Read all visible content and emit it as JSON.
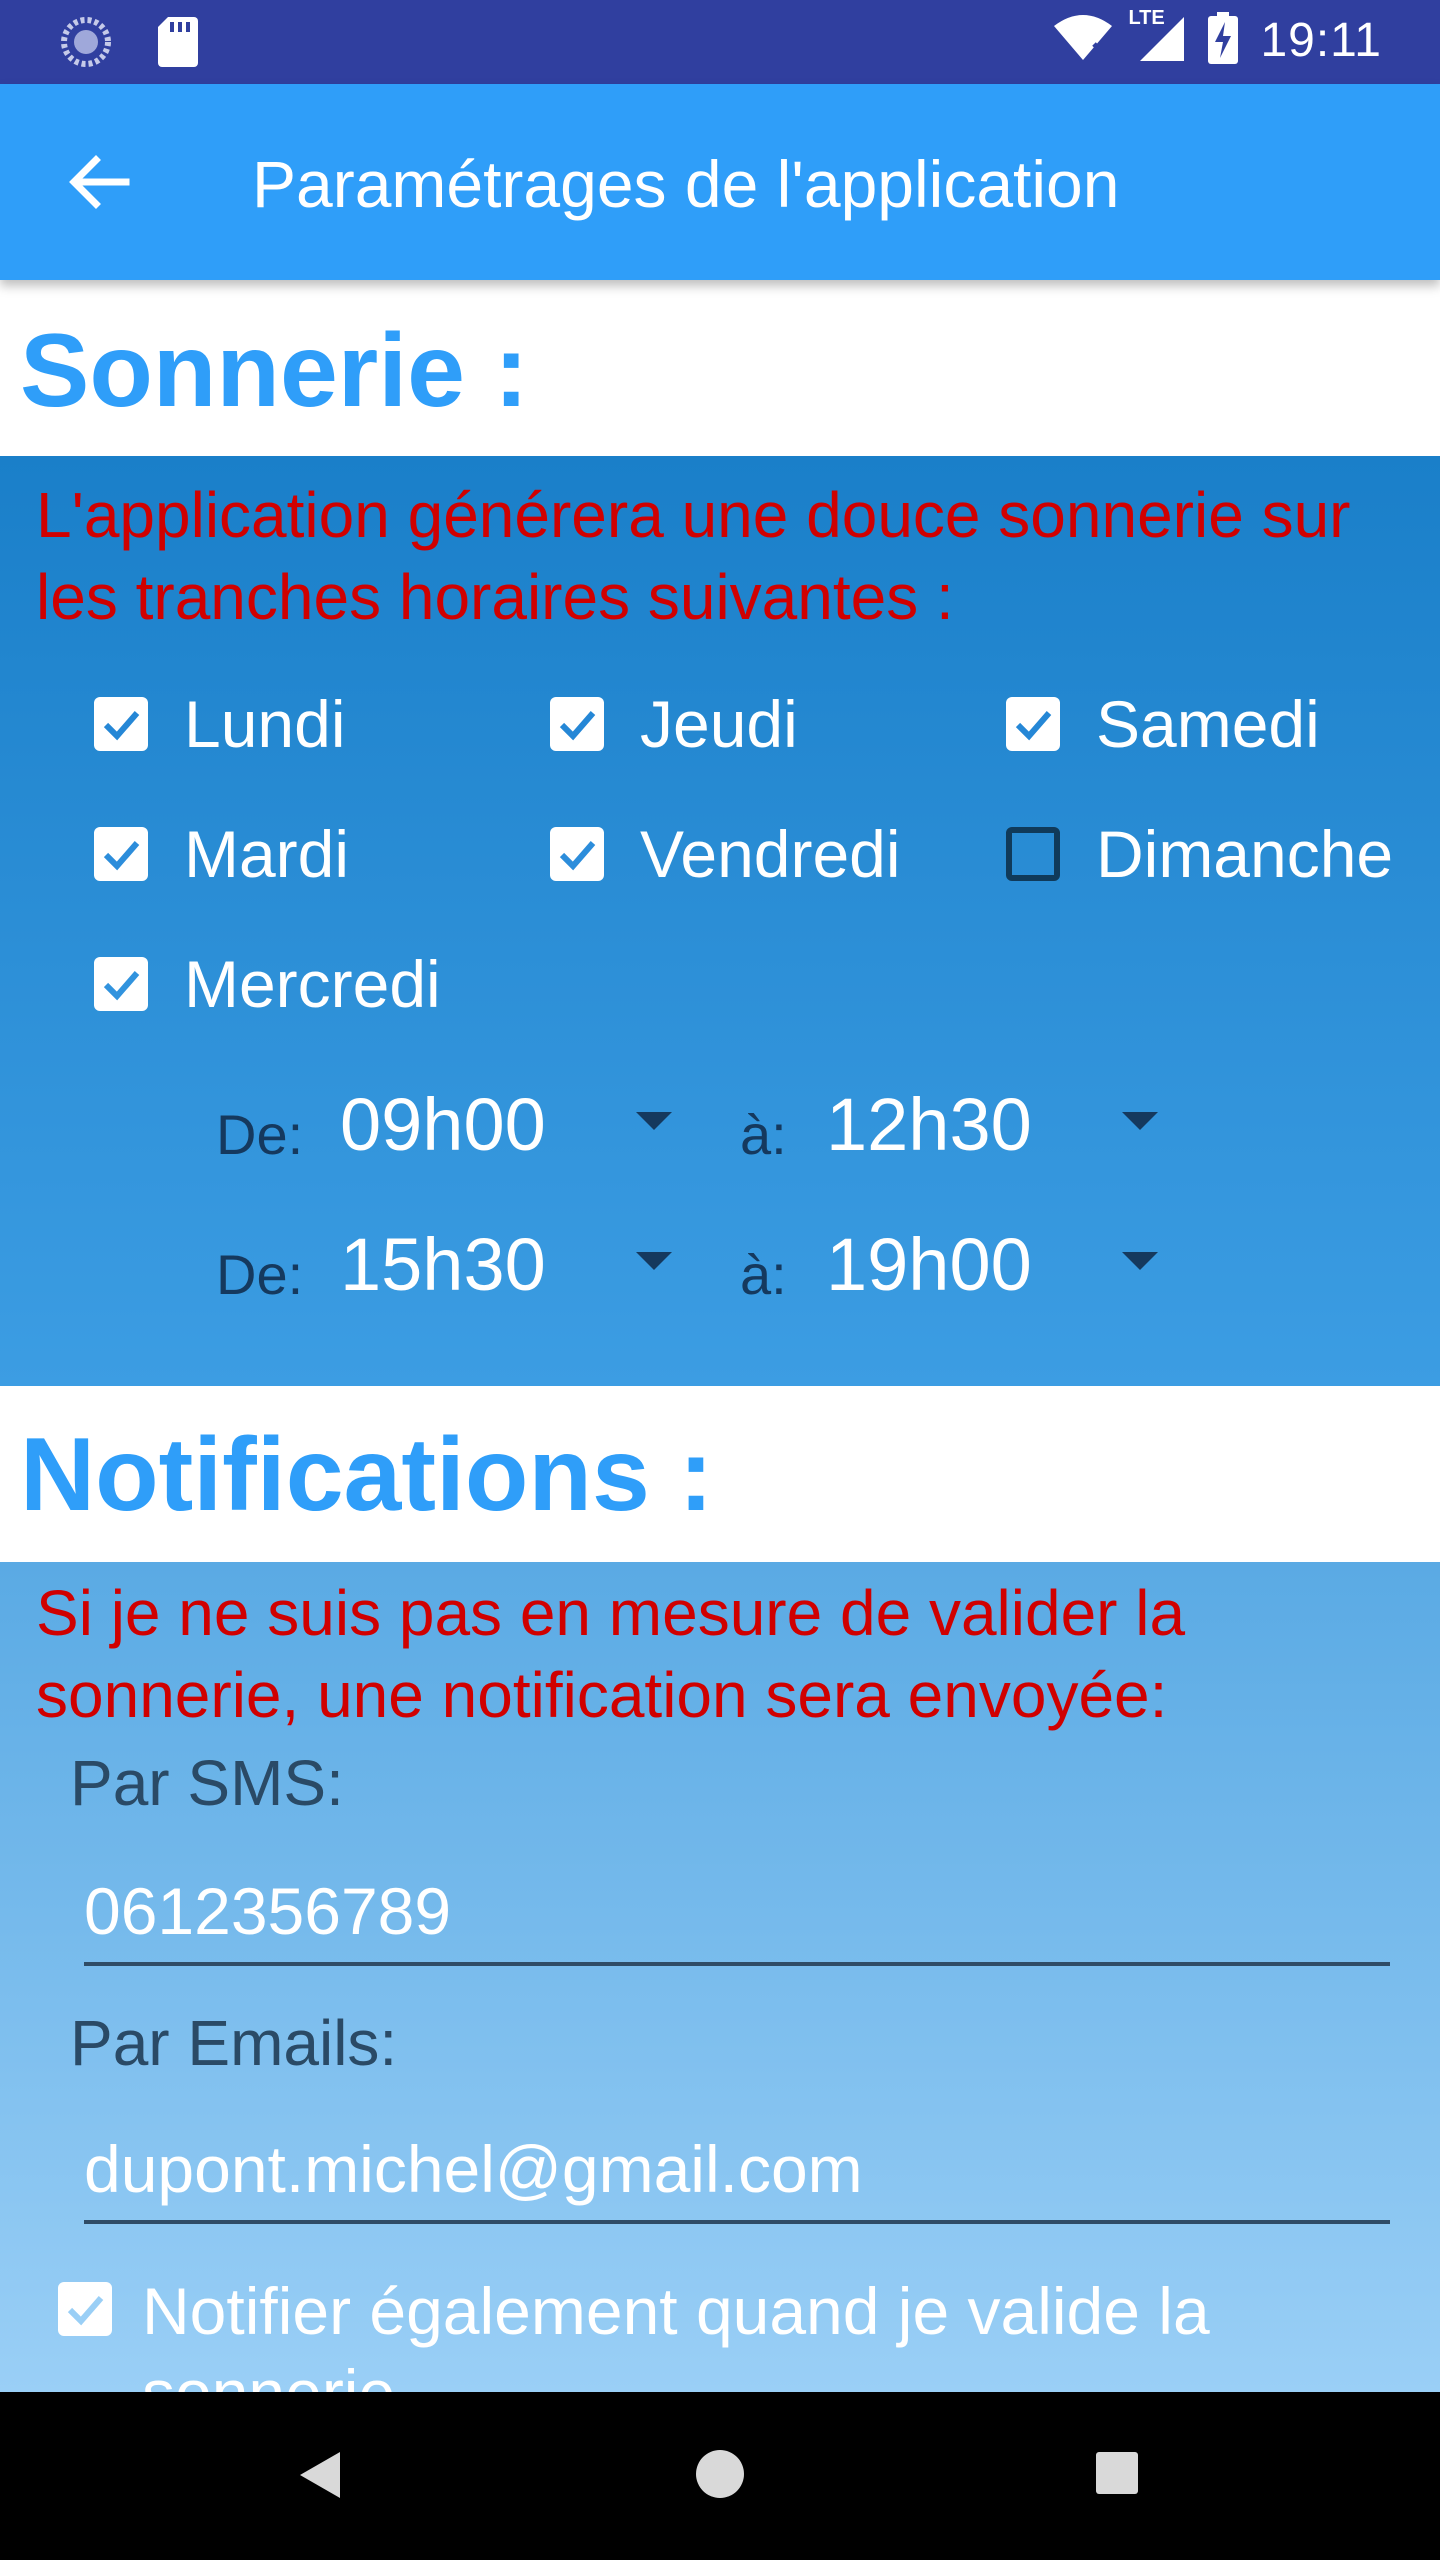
{
  "status_bar": {
    "time": "19:11",
    "network": "LTE",
    "icons": [
      "sync-icon",
      "sd-card-icon",
      "wifi-icon",
      "signal-icon",
      "battery-charging-icon"
    ]
  },
  "app_bar": {
    "title": "Paramétrages de l'application",
    "back_icon": "arrow-back-icon"
  },
  "sonnerie": {
    "heading": "Sonnerie :",
    "description": "L'application générera une douce sonnerie sur les tranches horaires suivantes :",
    "days": [
      {
        "label": "Lundi",
        "checked": true
      },
      {
        "label": "Mardi",
        "checked": true
      },
      {
        "label": "Mercredi",
        "checked": true
      },
      {
        "label": "Jeudi",
        "checked": true
      },
      {
        "label": "Vendredi",
        "checked": true
      },
      {
        "label": "Samedi",
        "checked": true
      },
      {
        "label": "Dimanche",
        "checked": false
      }
    ],
    "from_label": "De:",
    "to_label": "à:",
    "slots": [
      {
        "from": "09h00",
        "to": "12h30"
      },
      {
        "from": "15h30",
        "to": "19h00"
      }
    ]
  },
  "notifications": {
    "heading": "Notifications :",
    "description": "Si je ne suis pas en mesure de valider la sonnerie, une notification sera envoyée:",
    "sms_label": "Par SMS:",
    "sms_value": "0612356789",
    "email_label": "Par Emails:",
    "email_value": "dupont.michel@gmail.com",
    "notify_on_validate": {
      "label": "Notifier également quand je valide la sonnerie",
      "checked": true
    }
  },
  "colors": {
    "status_bar": "#303f9f",
    "app_bar": "#2f9ef9",
    "heading": "#2f9ef9",
    "warning_text": "#d00000"
  }
}
